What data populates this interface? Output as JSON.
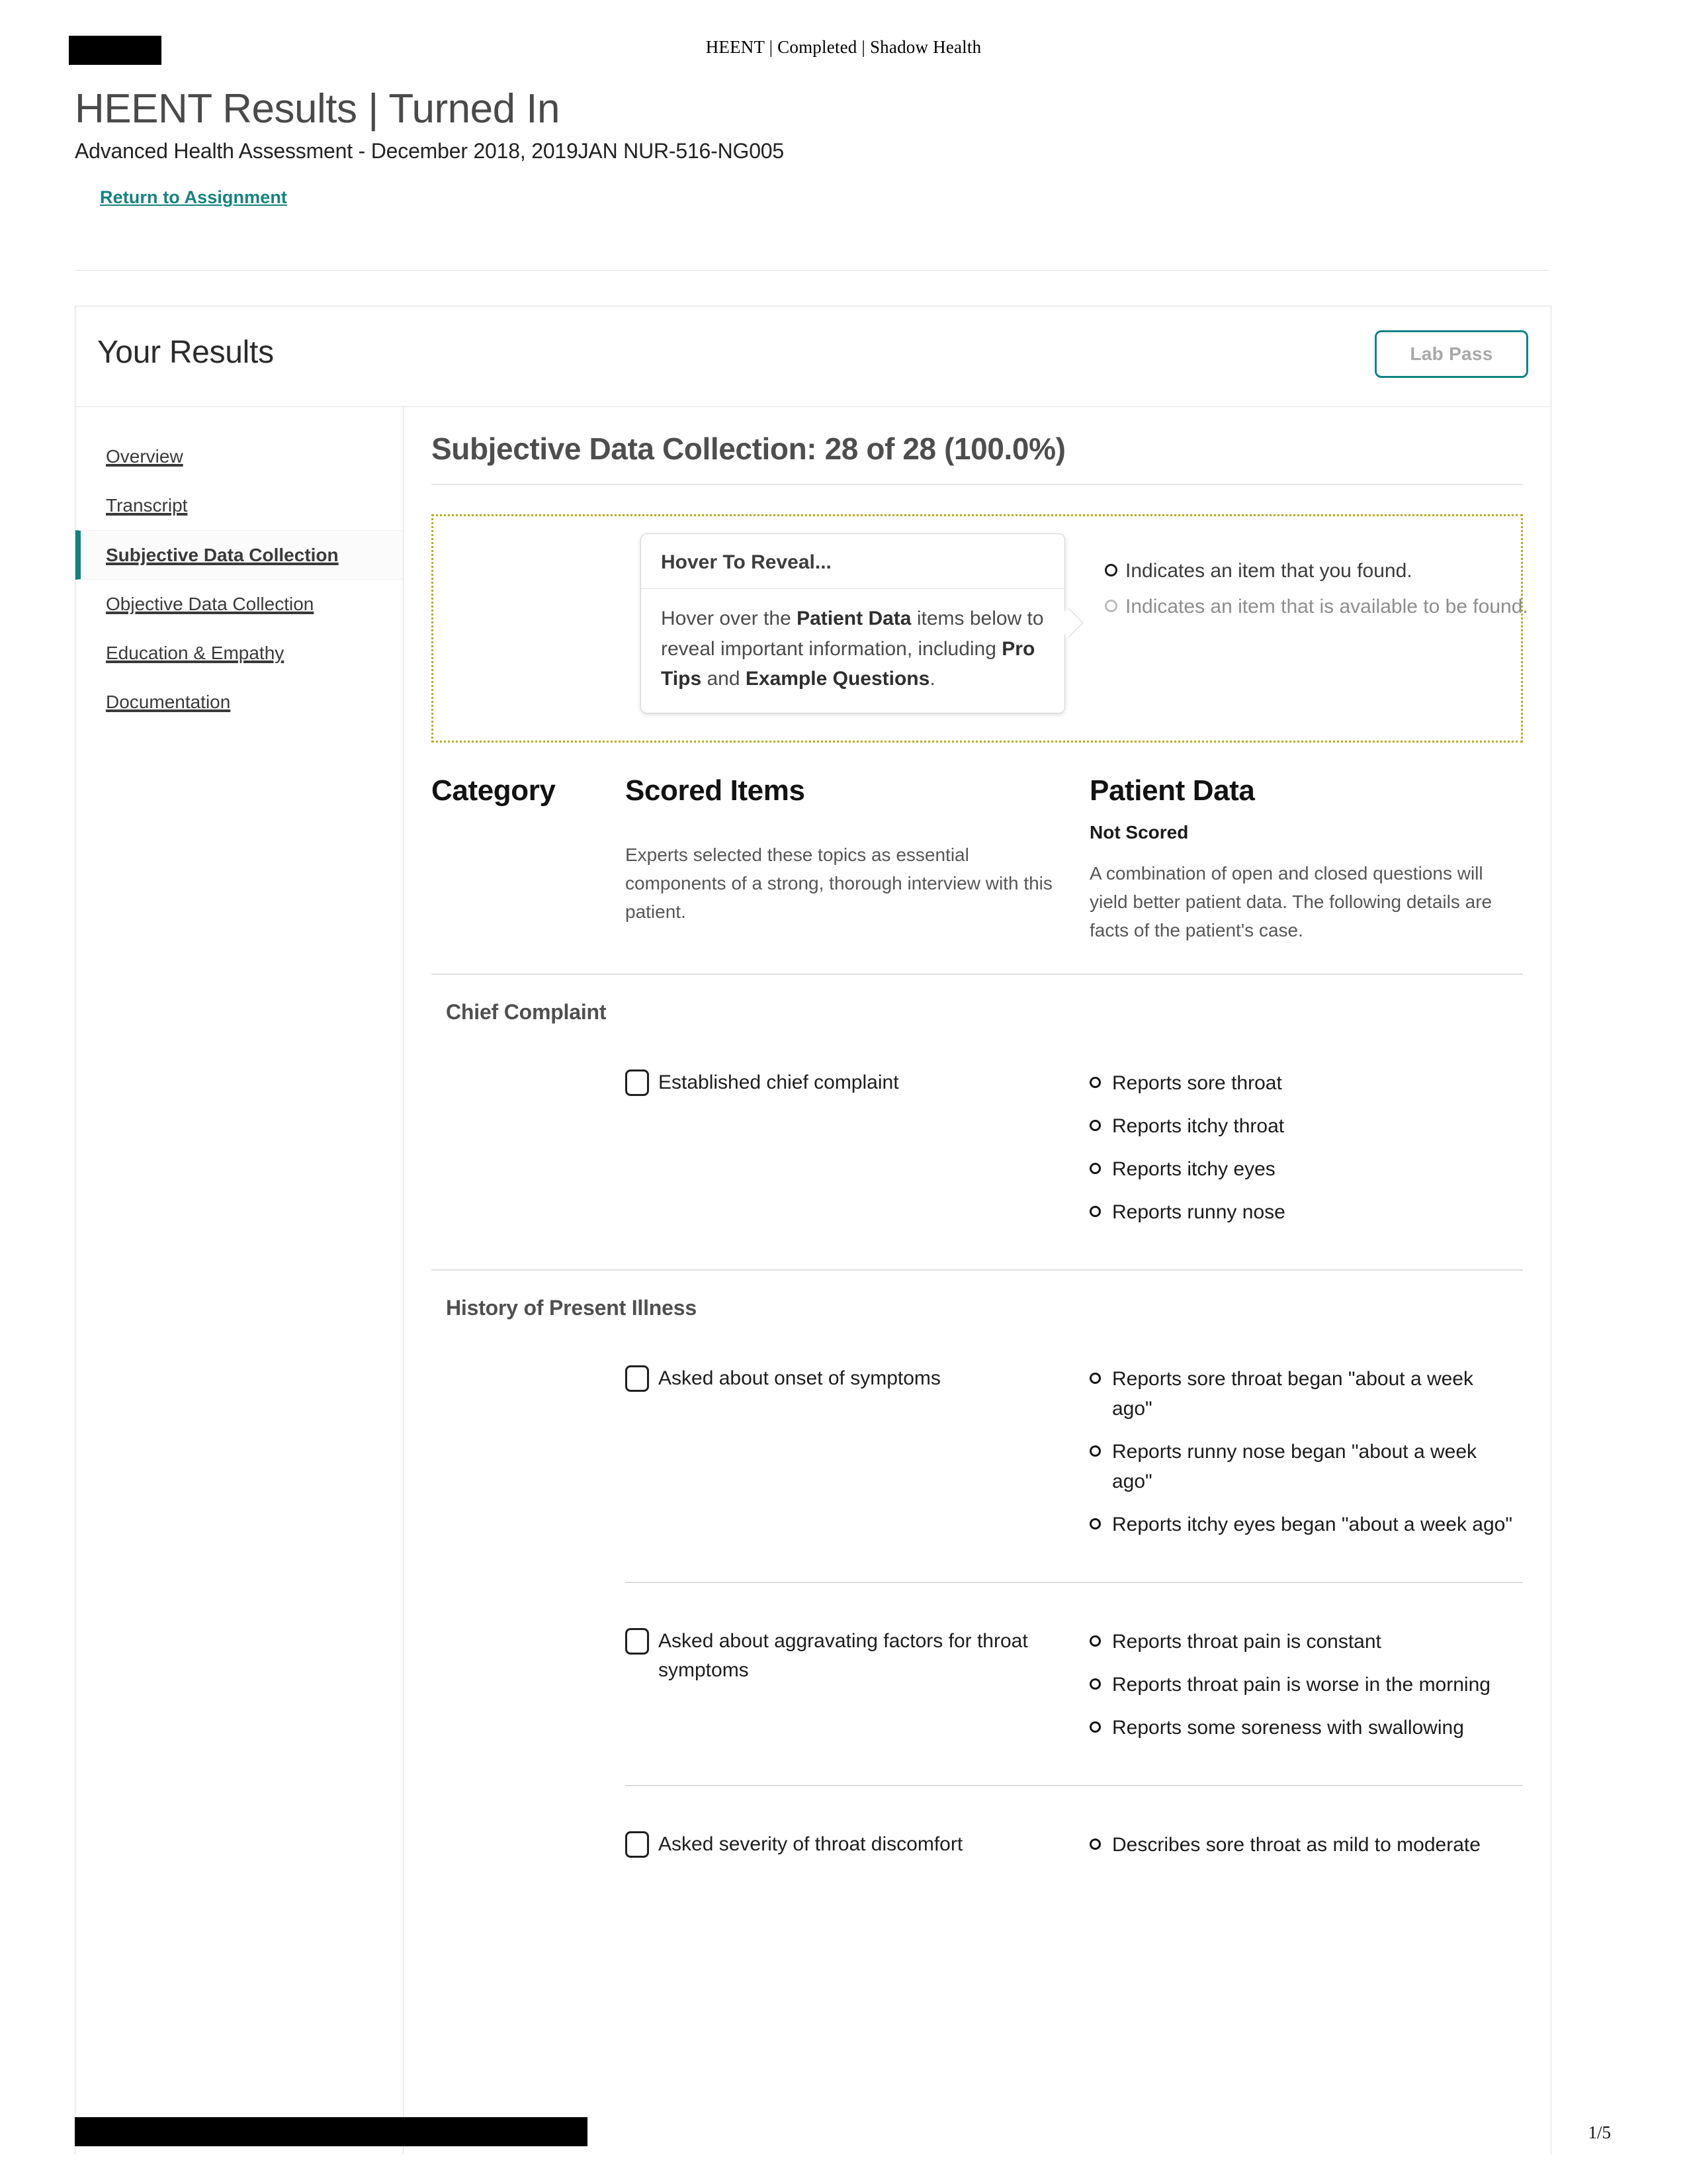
{
  "running_header": "HEENT | Completed | Shadow Health",
  "title": {
    "heading": "HEENT Results | Turned In",
    "subtitle": "Advanced Health Assessment - December 2018, 2019JAN NUR-516-NG005",
    "return_link": "Return to Assignment"
  },
  "card": {
    "heading": "Your Results",
    "lab_pass_label": "Lab Pass"
  },
  "sidebar": {
    "items": [
      {
        "label": "Overview",
        "active": false
      },
      {
        "label": "Transcript",
        "active": false
      },
      {
        "label": "Subjective Data Collection",
        "active": true
      },
      {
        "label": "Objective Data Collection",
        "active": false
      },
      {
        "label": "Education & Empathy",
        "active": false
      },
      {
        "label": "Documentation",
        "active": false
      }
    ]
  },
  "main": {
    "section_title": "Subjective Data Collection: 28 of 28 (100.0%)",
    "tooltip": {
      "title": "Hover To Reveal...",
      "body_prefix": "Hover over the ",
      "body_bold_1": "Patient Data",
      "body_mid_1": " items below to reveal important information, including ",
      "body_bold_2": "Pro Tips",
      "body_mid_2": " and ",
      "body_bold_3": "Example Questions",
      "body_suffix": "."
    },
    "legend": [
      {
        "text": "Indicates an item that you found.",
        "state": "found"
      },
      {
        "text": "Indicates an item that is available to be found.",
        "state": "available"
      }
    ],
    "columns": {
      "category": "Category",
      "scored_items": "Scored Items",
      "patient_data": "Patient Data",
      "not_scored": "Not Scored",
      "scored_items_desc": "Experts selected these topics as essential components of a strong, thorough interview with this patient.",
      "patient_data_desc": "A combination of open and closed questions will yield better patient data. The following details are facts of the patient's case."
    },
    "categories": [
      {
        "name": "Chief Complaint",
        "rows": [
          {
            "item": "Established chief complaint",
            "checked": false,
            "patient_data": [
              "Reports sore throat",
              "Reports itchy throat",
              "Reports itchy eyes",
              "Reports runny nose"
            ]
          }
        ]
      },
      {
        "name": "History of Present Illness",
        "rows": [
          {
            "item": "Asked about onset of symptoms",
            "checked": false,
            "patient_data": [
              "Reports sore throat began \"about a week ago\"",
              "Reports runny nose began \"about a week ago\"",
              "Reports itchy eyes began \"about a week ago\""
            ]
          },
          {
            "item": "Asked about aggravating factors for throat symptoms",
            "checked": false,
            "patient_data": [
              "Reports throat pain is constant",
              "Reports throat pain is worse in the morning",
              "Reports some soreness with swallowing"
            ]
          },
          {
            "item": "Asked severity of throat discomfort",
            "checked": false,
            "patient_data": [
              "Describes sore throat as mild to moderate"
            ]
          }
        ]
      }
    ]
  },
  "footer": {
    "page_number": "1/5"
  }
}
